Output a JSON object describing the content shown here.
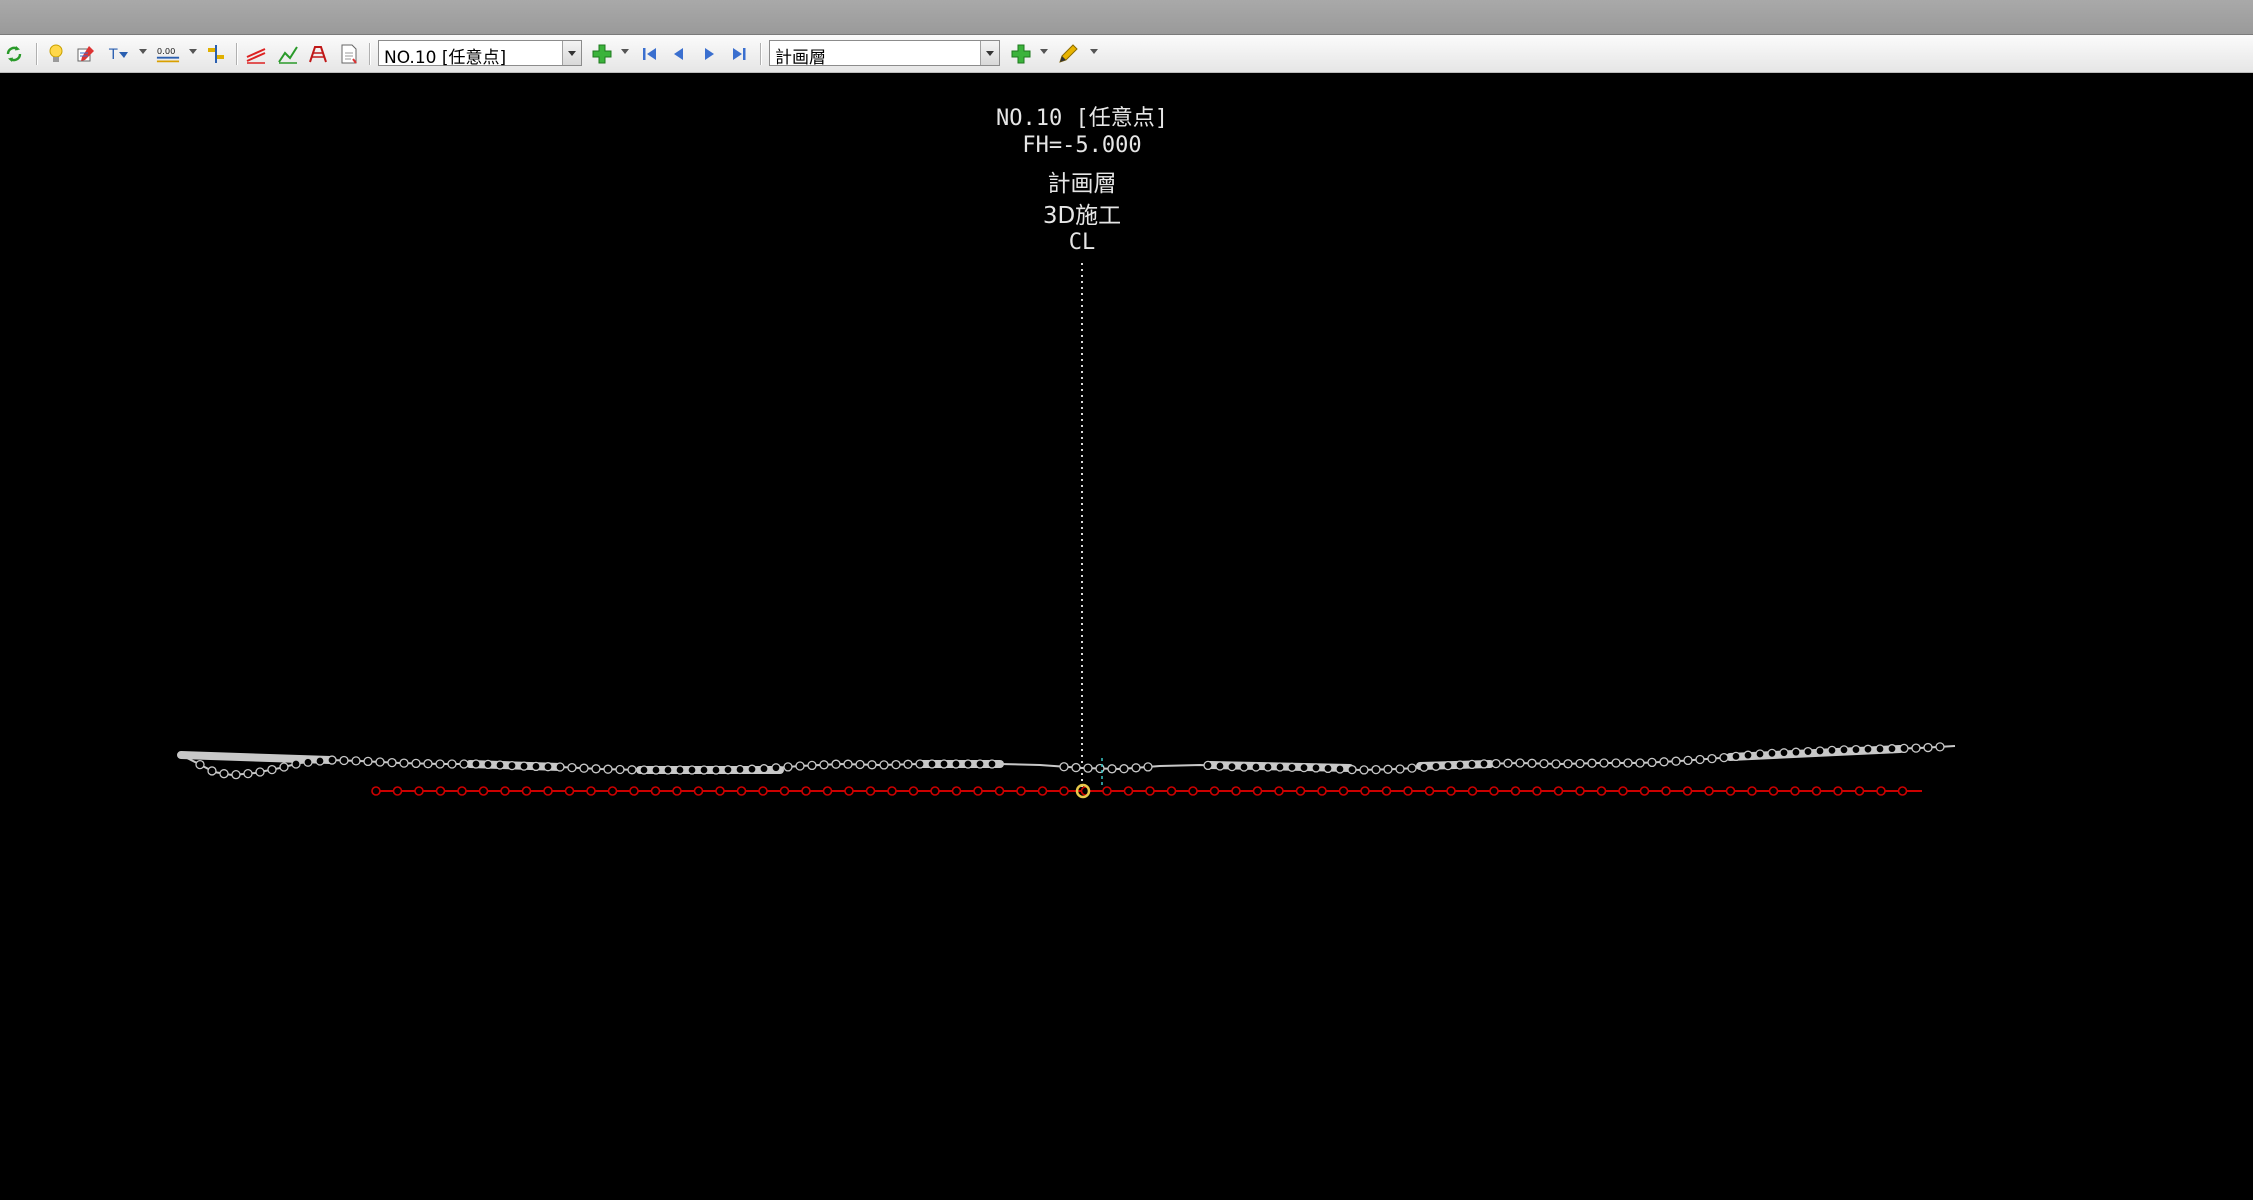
{
  "toolbar": {
    "station_select": {
      "value": "NO.10 [任意点]"
    },
    "layer_select": {
      "value": "計画層"
    },
    "icons": [
      "refresh-icon",
      "lightbulb-icon",
      "edit-section-icon",
      "text-format-icon",
      "elevation-display-icon",
      "align-icon",
      "cut-fill-icon",
      "slope-icon",
      "structure-icon",
      "document-icon",
      "add-icon",
      "first-icon",
      "previous-icon",
      "next-icon",
      "last-icon",
      "add-layer-icon",
      "pencil-icon"
    ],
    "elevation_icon_text": "0.00"
  },
  "canvas": {
    "background": "#000000",
    "station_label": "NO.10 [任意点]",
    "fh_label": "FH=-5.000",
    "layer_label": "計画層",
    "mode_label": "3D施工",
    "cl_label": "CL",
    "colors": {
      "ground": "#c8c8c8",
      "plan": "#cc0000",
      "text": "#e6e6e6",
      "marker": "#e8c84a"
    }
  }
}
